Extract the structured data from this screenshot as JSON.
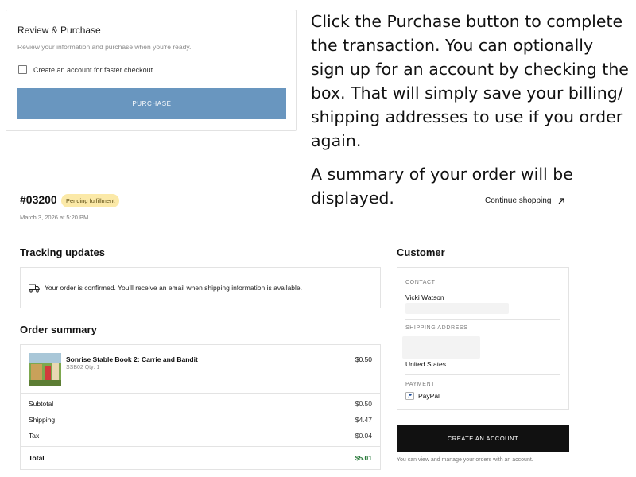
{
  "review": {
    "title": "Review & Purchase",
    "subtitle": "Review your information and purchase when you're ready.",
    "checkbox_label": "Create an account for faster checkout",
    "checkbox_checked": false,
    "purchase_label": "PURCHASE"
  },
  "instructions": {
    "para1": "Click the Purchase button to complete the transaction. You can optionally sign up for an account by checking the box. That will simply save your billing/ shipping addresses to use if you order again.",
    "para2": "A summary of your order will be displayed."
  },
  "order": {
    "number": "#03200",
    "status": "Pending fulfillment",
    "date": "March 3, 2026 at 5:20 PM",
    "continue_label": "Continue shopping"
  },
  "tracking": {
    "heading": "Tracking updates",
    "message": "Your order is confirmed. You'll receive an email when shipping information is available."
  },
  "summary": {
    "heading": "Order summary",
    "item": {
      "name": "Sonrise Stable Book 2: Carrie and Bandit",
      "sku": "SSB02 Qty: 1",
      "price": "$0.50"
    },
    "rows": [
      {
        "label": "Subtotal",
        "value": "$0.50"
      },
      {
        "label": "Shipping",
        "value": "$4.47"
      },
      {
        "label": "Tax",
        "value": "$0.04"
      }
    ],
    "total_label": "Total",
    "total_value": "$5.01"
  },
  "customer": {
    "heading": "Customer",
    "contact_label": "CONTACT",
    "contact_name": "Vicki Watson",
    "shipping_label": "SHIPPING ADDRESS",
    "country": "United States",
    "payment_label": "PAYMENT",
    "payment_method": "PayPal"
  },
  "account": {
    "create_label": "CREATE AN ACCOUNT",
    "note": "You can view and manage your orders with an account."
  },
  "colors": {
    "purchase_button": "#6996bf",
    "status_badge": "#fbe9a8",
    "total_green": "#2a7a3b",
    "create_button": "#111111"
  }
}
